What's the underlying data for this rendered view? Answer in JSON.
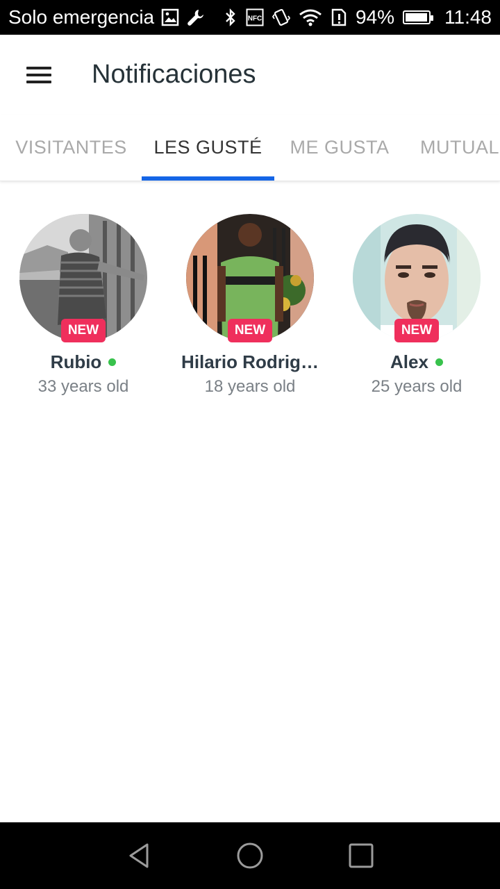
{
  "status_bar": {
    "carrier": "Solo emergencia",
    "battery": "94%",
    "time": "11:48",
    "icons": [
      "image-icon",
      "wrench-icon",
      "bluetooth-icon",
      "nfc-icon",
      "vibrate-icon",
      "wifi-icon",
      "sim-alert-icon",
      "battery-icon"
    ],
    "nfc_text": "NFC"
  },
  "app_bar": {
    "title": "Notificaciones",
    "menu_icon": "hamburger-menu-icon"
  },
  "tabs": [
    {
      "label": "VISITANTES",
      "active": false
    },
    {
      "label": "LES GUSTÉ",
      "active": true
    },
    {
      "label": "ME GUSTA",
      "active": false
    },
    {
      "label": "MUTUAL",
      "active": false
    }
  ],
  "colors": {
    "accent": "#1565e6",
    "badge": "#ef2f5c",
    "online": "#38c24c",
    "inactive_tab": "#a9a9a9"
  },
  "users": [
    {
      "name": "Rubio",
      "age": "33 years old",
      "badge": "NEW",
      "online": true
    },
    {
      "name": "Hilario Rodrig…",
      "age": "18 years old",
      "badge": "NEW",
      "online": false
    },
    {
      "name": "Alex",
      "age": "25 years old",
      "badge": "NEW",
      "online": true
    }
  ],
  "nav_bar": {
    "icons": [
      "back-icon",
      "home-icon",
      "recents-icon"
    ]
  }
}
